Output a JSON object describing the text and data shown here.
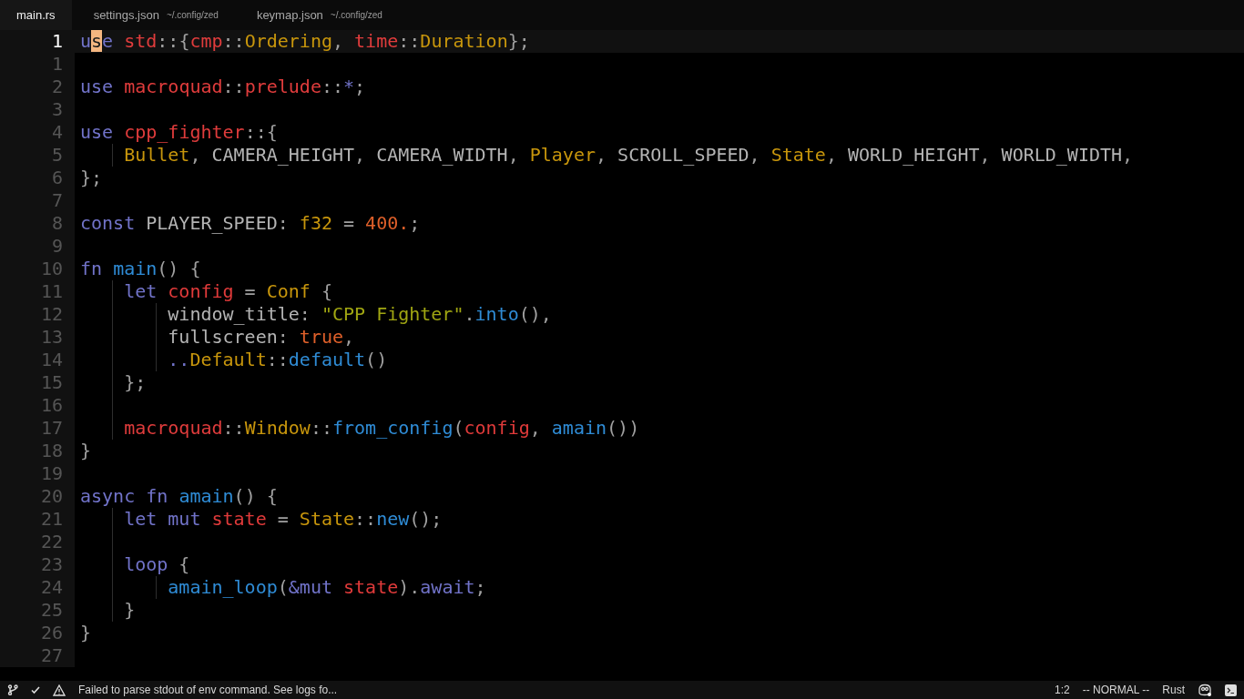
{
  "tabs": [
    {
      "label": "main.rs",
      "selected": true
    },
    {
      "label": "settings.json",
      "path": "~/.config/zed",
      "selected": false
    },
    {
      "label": "keymap.json",
      "path": "~/.config/zed",
      "selected": false
    }
  ],
  "lines": [
    {
      "number": "1",
      "current": true,
      "tokens": [
        {
          "kind": "kw",
          "text": "u"
        },
        {
          "kind": "cursor",
          "text": "s"
        },
        {
          "kind": "kw",
          "text": "e "
        },
        {
          "kind": "mod",
          "text": "std"
        },
        {
          "kind": "punc",
          "text": "::{"
        },
        {
          "kind": "mod",
          "text": "cmp"
        },
        {
          "kind": "punc",
          "text": "::"
        },
        {
          "kind": "type",
          "text": "Ordering"
        },
        {
          "kind": "punc",
          "text": ", "
        },
        {
          "kind": "mod",
          "text": "time"
        },
        {
          "kind": "punc",
          "text": "::"
        },
        {
          "kind": "type",
          "text": "Duration"
        },
        {
          "kind": "punc",
          "text": "};"
        }
      ]
    },
    {
      "number": "1",
      "current": false
    },
    {
      "number": "2",
      "current": false,
      "tokens": [
        {
          "kind": "kw",
          "text": "use "
        },
        {
          "kind": "mod",
          "text": "macroquad"
        },
        {
          "kind": "punc",
          "text": "::"
        },
        {
          "kind": "mod",
          "text": "prelude"
        },
        {
          "kind": "punc",
          "text": "::"
        },
        {
          "kind": "kw",
          "text": "*"
        },
        {
          "kind": "punc",
          "text": ";"
        }
      ]
    },
    {
      "number": "3",
      "current": false
    },
    {
      "number": "4",
      "current": false,
      "tokens": [
        {
          "kind": "kw",
          "text": "use "
        },
        {
          "kind": "mod",
          "text": "cpp_fighter"
        },
        {
          "kind": "punc",
          "text": "::{"
        }
      ]
    },
    {
      "number": "5",
      "current": false,
      "tokens": [
        {
          "kind": "type",
          "text": "    Bullet"
        },
        {
          "kind": "punc",
          "text": ", "
        },
        {
          "kind": "id",
          "text": "CAMERA_HEIGHT"
        },
        {
          "kind": "punc",
          "text": ", "
        },
        {
          "kind": "id",
          "text": "CAMERA_WIDTH"
        },
        {
          "kind": "punc",
          "text": ", "
        },
        {
          "kind": "type",
          "text": "Player"
        },
        {
          "kind": "punc",
          "text": ", "
        },
        {
          "kind": "id",
          "text": "SCROLL_SPEED"
        },
        {
          "kind": "punc",
          "text": ", "
        },
        {
          "kind": "type",
          "text": "State"
        },
        {
          "kind": "punc",
          "text": ", "
        },
        {
          "kind": "id",
          "text": "WORLD_HEIGHT"
        },
        {
          "kind": "punc",
          "text": ", "
        },
        {
          "kind": "id",
          "text": "WORLD_WIDTH"
        },
        {
          "kind": "punc",
          "text": ","
        }
      ]
    },
    {
      "number": "6",
      "current": false,
      "tokens": [
        {
          "kind": "punc",
          "text": "};"
        }
      ]
    },
    {
      "number": "7",
      "current": false
    },
    {
      "number": "8",
      "current": false,
      "tokens": [
        {
          "kind": "kw",
          "text": "const "
        },
        {
          "kind": "id",
          "text": "PLAYER_SPEED"
        },
        {
          "kind": "punc",
          "text": ": "
        },
        {
          "kind": "type",
          "text": "f32"
        },
        {
          "kind": "punc",
          "text": " = "
        },
        {
          "kind": "num",
          "text": "400."
        },
        {
          "kind": "punc",
          "text": ";"
        }
      ]
    },
    {
      "number": "9",
      "current": false
    },
    {
      "number": "10",
      "current": false,
      "tokens": [
        {
          "kind": "kw",
          "text": "fn "
        },
        {
          "kind": "fn",
          "text": "main"
        },
        {
          "kind": "punc",
          "text": "() {"
        }
      ]
    },
    {
      "number": "11",
      "current": false,
      "tokens": [
        {
          "kind": "kw",
          "text": "    let "
        },
        {
          "kind": "var",
          "text": "config"
        },
        {
          "kind": "punc",
          "text": " = "
        },
        {
          "kind": "type",
          "text": "Conf"
        },
        {
          "kind": "punc",
          "text": " {"
        }
      ]
    },
    {
      "number": "12",
      "current": false,
      "tokens": [
        {
          "kind": "id",
          "text": "        window_title"
        },
        {
          "kind": "punc",
          "text": ": "
        },
        {
          "kind": "str",
          "text": "\"CPP Fighter\""
        },
        {
          "kind": "punc",
          "text": "."
        },
        {
          "kind": "fn",
          "text": "into"
        },
        {
          "kind": "punc",
          "text": "(),"
        }
      ]
    },
    {
      "number": "13",
      "current": false,
      "tokens": [
        {
          "kind": "id",
          "text": "        fullscreen"
        },
        {
          "kind": "punc",
          "text": ": "
        },
        {
          "kind": "num",
          "text": "true"
        },
        {
          "kind": "punc",
          "text": ","
        }
      ]
    },
    {
      "number": "14",
      "current": false,
      "tokens": [
        {
          "kind": "kw",
          "text": "        .."
        },
        {
          "kind": "type",
          "text": "Default"
        },
        {
          "kind": "punc",
          "text": "::"
        },
        {
          "kind": "fn",
          "text": "default"
        },
        {
          "kind": "punc",
          "text": "()"
        }
      ]
    },
    {
      "number": "15",
      "current": false,
      "tokens": [
        {
          "kind": "punc",
          "text": "    };"
        }
      ]
    },
    {
      "number": "16",
      "current": false
    },
    {
      "number": "17",
      "current": false,
      "tokens": [
        {
          "kind": "mod",
          "text": "    macroquad"
        },
        {
          "kind": "punc",
          "text": "::"
        },
        {
          "kind": "type",
          "text": "Window"
        },
        {
          "kind": "punc",
          "text": "::"
        },
        {
          "kind": "fn",
          "text": "from_config"
        },
        {
          "kind": "punc",
          "text": "("
        },
        {
          "kind": "var",
          "text": "config"
        },
        {
          "kind": "punc",
          "text": ", "
        },
        {
          "kind": "fn",
          "text": "amain"
        },
        {
          "kind": "punc",
          "text": "())"
        }
      ]
    },
    {
      "number": "18",
      "current": false,
      "tokens": [
        {
          "kind": "punc",
          "text": "}"
        }
      ]
    },
    {
      "number": "19",
      "current": false
    },
    {
      "number": "20",
      "current": false,
      "tokens": [
        {
          "kind": "kw",
          "text": "async fn "
        },
        {
          "kind": "fn",
          "text": "amain"
        },
        {
          "kind": "punc",
          "text": "() {"
        }
      ]
    },
    {
      "number": "21",
      "current": false,
      "tokens": [
        {
          "kind": "kw",
          "text": "    let mut "
        },
        {
          "kind": "var",
          "text": "state"
        },
        {
          "kind": "punc",
          "text": " = "
        },
        {
          "kind": "type",
          "text": "State"
        },
        {
          "kind": "punc",
          "text": "::"
        },
        {
          "kind": "fn",
          "text": "new"
        },
        {
          "kind": "punc",
          "text": "();"
        }
      ]
    },
    {
      "number": "22",
      "current": false
    },
    {
      "number": "23",
      "current": false,
      "tokens": [
        {
          "kind": "kw",
          "text": "    loop"
        },
        {
          "kind": "punc",
          "text": " {"
        }
      ]
    },
    {
      "number": "24",
      "current": false,
      "tokens": [
        {
          "kind": "fn",
          "text": "        amain_loop"
        },
        {
          "kind": "punc",
          "text": "("
        },
        {
          "kind": "kw",
          "text": "&mut "
        },
        {
          "kind": "var",
          "text": "state"
        },
        {
          "kind": "punc",
          "text": ")."
        },
        {
          "kind": "kw",
          "text": "await"
        },
        {
          "kind": "punc",
          "text": ";"
        }
      ]
    },
    {
      "number": "25",
      "current": false,
      "tokens": [
        {
          "kind": "punc",
          "text": "    }"
        }
      ]
    },
    {
      "number": "26",
      "current": false,
      "tokens": [
        {
          "kind": "punc",
          "text": "}"
        }
      ]
    },
    {
      "number": "27",
      "current": false
    }
  ],
  "status_bar": {
    "message": "Failed to parse stdout of env command. See logs fo...",
    "position": "1:2",
    "mode": "-- NORMAL --",
    "language": "Rust"
  }
}
